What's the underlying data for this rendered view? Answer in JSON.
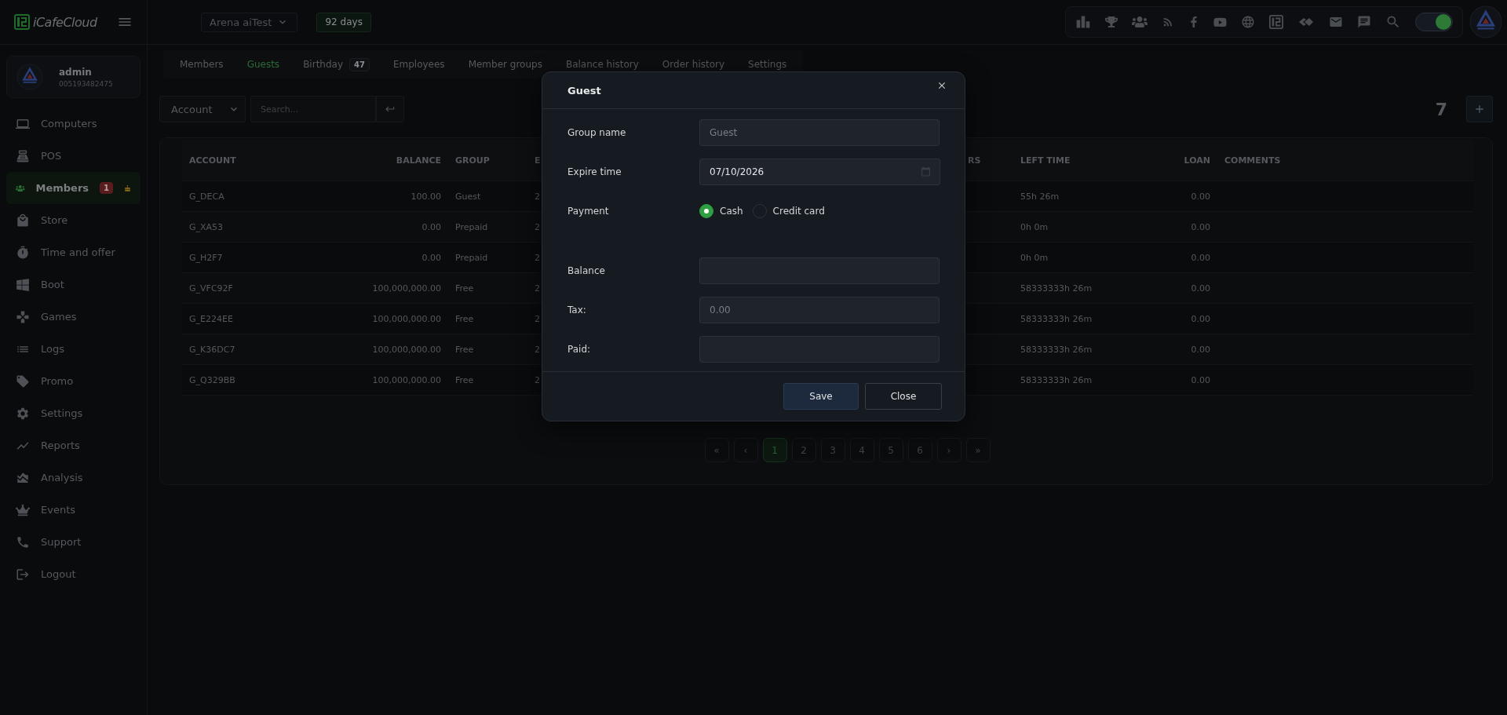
{
  "topbar": {
    "logo": "iCafeCloud",
    "branch_select": "Arena aiTest",
    "days_badge": "92 days",
    "theme_toggle": {
      "on": true
    }
  },
  "profile": {
    "name": "admin",
    "phone": "005193482475"
  },
  "sidebar": {
    "items": [
      {
        "label": "Computers",
        "selected": false
      },
      {
        "label": "POS",
        "selected": false
      },
      {
        "label": "Members",
        "selected": true,
        "badge": "1"
      },
      {
        "label": "Store",
        "selected": false
      },
      {
        "label": "Time and offer",
        "selected": false
      },
      {
        "label": "Boot",
        "selected": false
      },
      {
        "label": "Games",
        "selected": false
      },
      {
        "label": "Logs",
        "selected": false
      },
      {
        "label": "Promo",
        "selected": false
      },
      {
        "label": "Settings",
        "selected": false
      },
      {
        "label": "Reports",
        "selected": false
      },
      {
        "label": "Analysis",
        "selected": false
      },
      {
        "label": "Events",
        "selected": false
      },
      {
        "label": "Support",
        "selected": false
      },
      {
        "label": "Logout",
        "selected": false
      }
    ]
  },
  "tabs": [
    {
      "label": "Members",
      "selected": false
    },
    {
      "label": "Guests",
      "selected": true
    },
    {
      "label": "Birthday",
      "selected": false,
      "badge": "47"
    },
    {
      "label": "Employees",
      "selected": false
    },
    {
      "label": "Member groups",
      "selected": false
    },
    {
      "label": "Balance history",
      "selected": false
    },
    {
      "label": "Order history",
      "selected": false
    },
    {
      "label": "Settings",
      "selected": false
    }
  ],
  "filter": {
    "select": "Account",
    "search": {
      "placeholder": "Search..."
    },
    "count": "7"
  },
  "table": {
    "columns": [
      "ACCOUNT",
      "BALANCE",
      "GROUP",
      "E",
      "RS",
      "LEFT TIME",
      "LOAN",
      "COMMENTS"
    ],
    "rows": [
      {
        "account": "G_DECA",
        "balance": "100.00",
        "group": "Guest",
        "column_4": "2",
        "left_time": "55h 26m",
        "loan": "0.00"
      },
      {
        "account": "G_XA53",
        "balance": "0.00",
        "group": "Prepaid",
        "column_4": "2",
        "left_time": "0h 0m",
        "loan": "0.00"
      },
      {
        "account": "G_H2F7",
        "balance": "0.00",
        "group": "Prepaid",
        "column_4": "2",
        "left_time": "0h 0m",
        "loan": "0.00"
      },
      {
        "account": "G_VFC92F",
        "balance": "100,000,000.00",
        "group": "Free",
        "column_4": "2",
        "left_time": "58333333h 26m",
        "loan": "0.00"
      },
      {
        "account": "G_E224EE",
        "balance": "100,000,000.00",
        "group": "Free",
        "column_4": "2",
        "left_time": "58333333h 26m",
        "loan": "0.00"
      },
      {
        "account": "G_K36DC7",
        "balance": "100,000,000.00",
        "group": "Free",
        "column_4": "2",
        "left_time": "58333333h 26m",
        "loan": "0.00"
      },
      {
        "account": "G_Q329BB",
        "balance": "100,000,000.00",
        "group": "Free",
        "column_4": "2",
        "left_time": "58333333h 26m",
        "loan": "0.00"
      }
    ]
  },
  "pagination": [
    {
      "label": "«",
      "selected": false
    },
    {
      "label": "‹",
      "selected": false
    },
    {
      "label": "1",
      "selected": true
    },
    {
      "label": "2",
      "selected": false
    },
    {
      "label": "3",
      "selected": false
    },
    {
      "label": "4",
      "selected": false
    },
    {
      "label": "5",
      "selected": false
    },
    {
      "label": "6",
      "selected": false
    },
    {
      "label": "›",
      "selected": false
    },
    {
      "label": "»",
      "selected": false
    }
  ],
  "modal": {
    "title": "Guest",
    "fields": [
      {
        "kind": "text",
        "label": "Group name",
        "placeholder": "Guest"
      },
      {
        "kind": "date",
        "label": "Expire time",
        "value": "07/10/2026"
      },
      {
        "kind": "radio",
        "label": "Payment",
        "options": [
          {
            "label": "Cash",
            "selected": true
          },
          {
            "label": "Credit card",
            "selected": false
          }
        ]
      },
      {
        "kind": "text",
        "label": "Balance"
      },
      {
        "kind": "text",
        "label": "Tax:",
        "placeholder": "0.00"
      },
      {
        "kind": "text",
        "label": "Paid:"
      }
    ],
    "buttons": [
      {
        "label": "Save",
        "kind": "primary"
      },
      {
        "label": "Close",
        "kind": "secondary"
      }
    ]
  }
}
